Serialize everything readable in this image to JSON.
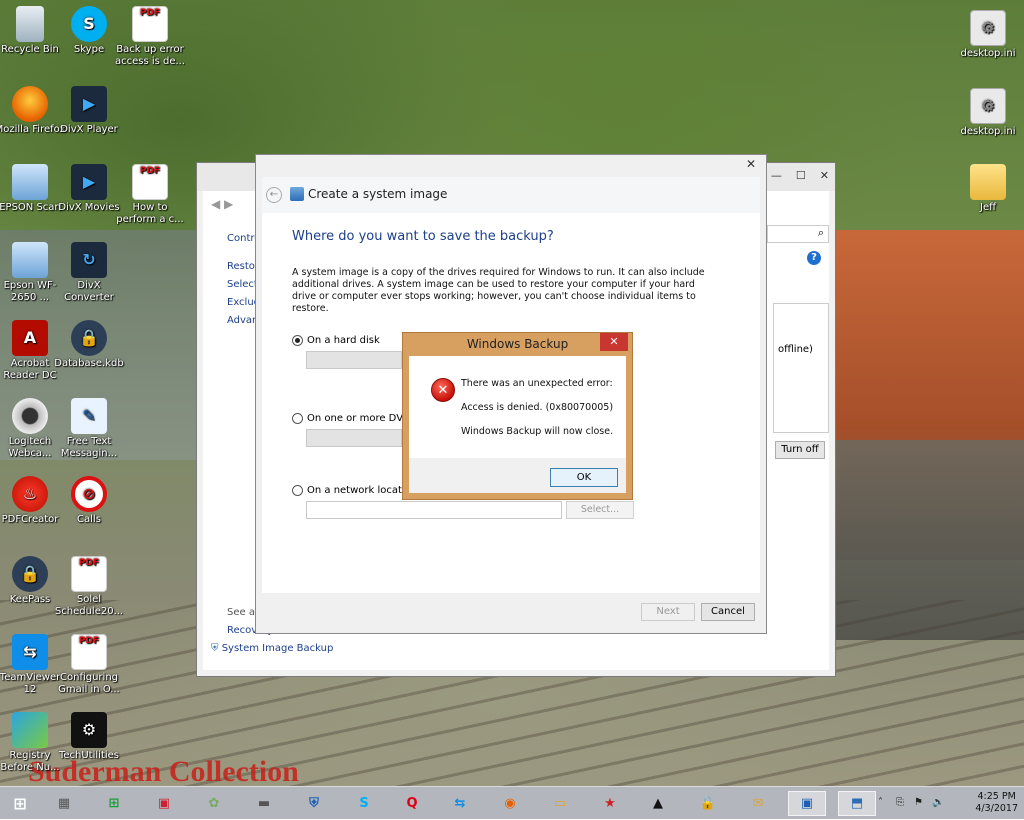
{
  "desktop": {
    "watermark": "Suderman Collection",
    "icons": [
      {
        "label": "Recycle Bin",
        "glyph": "🗑"
      },
      {
        "label": "Skype",
        "glyph": "S"
      },
      {
        "label": "Back up error access is de...",
        "glyph": "PDF"
      },
      {
        "label": "Mozilla Firefox",
        "glyph": ""
      },
      {
        "label": "DivX Player",
        "glyph": "▶"
      },
      {
        "label": "EPSON Scan",
        "glyph": ""
      },
      {
        "label": "DivX Movies",
        "glyph": "▶"
      },
      {
        "label": "How to perform a c...",
        "glyph": "PDF"
      },
      {
        "label": "Epson WF-2650 ...",
        "glyph": ""
      },
      {
        "label": "DivX Converter",
        "glyph": "↻"
      },
      {
        "label": "Acrobat Reader DC",
        "glyph": "A"
      },
      {
        "label": "Database.kdb",
        "glyph": "🔒"
      },
      {
        "label": "Logitech Webca...",
        "glyph": ""
      },
      {
        "label": "Free Text Messagin...",
        "glyph": "✎"
      },
      {
        "label": "PDFCreator",
        "glyph": "♨"
      },
      {
        "label": "Calls",
        "glyph": "⊘"
      },
      {
        "label": "KeePass",
        "glyph": "🔒"
      },
      {
        "label": "Solel Schedule20...",
        "glyph": "PDF"
      },
      {
        "label": "TeamViewer 12",
        "glyph": "⇆"
      },
      {
        "label": "Configuring Gmail in O...",
        "glyph": "PDF"
      },
      {
        "label": "Registry Before Nu...",
        "glyph": ""
      },
      {
        "label": "TechUtilities",
        "glyph": "⚙"
      },
      {
        "label": "desktop.ini",
        "glyph": "⚙"
      },
      {
        "label": "desktop.ini",
        "glyph": "⚙"
      },
      {
        "label": "Jeff",
        "glyph": ""
      }
    ]
  },
  "control_panel": {
    "sidebar": [
      "Contro",
      "Restore",
      "Select",
      "Exclude",
      "Advanc"
    ],
    "see_also": "See also",
    "recovery": "Recovery",
    "system_image_backup": "System Image Backup",
    "panel_text": "offline)",
    "turn_off": "Turn off",
    "help": "?"
  },
  "wizard": {
    "title": "Create a system image",
    "heading": "Where do you want to save the backup?",
    "description": "A system image is a copy of the drives required for Windows to run. It can also include additional drives. A system image can be used to restore your computer if your hard drive or computer ever stops working; however, you can't choose individual items to restore.",
    "options": {
      "hard_disk": "On a hard disk",
      "dvds": "On one or more DVDs",
      "network": "On a network location"
    },
    "select_button": "Select...",
    "next_button": "Next",
    "cancel_button": "Cancel"
  },
  "error_dialog": {
    "title": "Windows Backup",
    "line1": "There was an unexpected error:",
    "line2": "Access is denied. (0x80070005)",
    "line3": "Windows Backup will now close.",
    "ok_button": "OK"
  },
  "taskbar": {
    "time": "4:25 PM",
    "date": "4/3/2017"
  }
}
